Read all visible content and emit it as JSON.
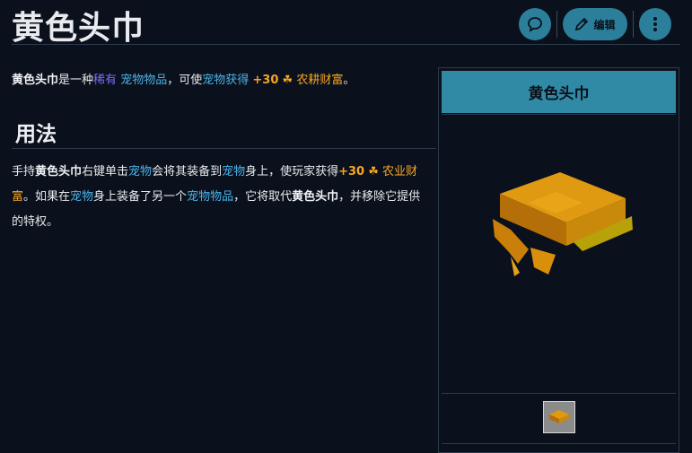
{
  "page": {
    "title": "黄色头巾"
  },
  "toolbar": {
    "comment_icon": "speech-bubble-icon",
    "edit_icon": "pencil-icon",
    "edit_label": "编辑",
    "more_icon": "vertical-ellipsis-icon"
  },
  "intro": {
    "name": "黄色头巾",
    "t1": "是一种",
    "rarity": "稀有",
    "t2": " ",
    "pet_item": "宠物物品",
    "t3": "，可使",
    "pet": "宠物",
    "t4": "获得",
    "bonus": "+30",
    "stat": "农耕财富",
    "end": "。"
  },
  "usage": {
    "heading": "用法",
    "p1": "手持",
    "name1": "黄色头巾",
    "p2": "右键单击",
    "pet1": "宠物",
    "p3": "会将其装备到",
    "pet2": "宠物",
    "p4": "身上，使玩家获得",
    "bonus": "+30",
    "stat": "农业财富",
    "p5": "。如果在",
    "pet3": "宠物",
    "p6": "身上装备了另一个",
    "pet_item": "宠物物品",
    "p7": "，它将取代",
    "name2": "黄色头巾",
    "p8": "，并移除它提供的特权。"
  },
  "infobox": {
    "title": "黄色头巾",
    "image": "yellow-bandana-render",
    "thumb": "yellow-bandana-item-icon"
  },
  "colors": {
    "background": "#0b111c",
    "accent": "#318aa5",
    "rare": "#7b6cff",
    "link": "#4bb3ea",
    "gold": "#f5a623"
  }
}
